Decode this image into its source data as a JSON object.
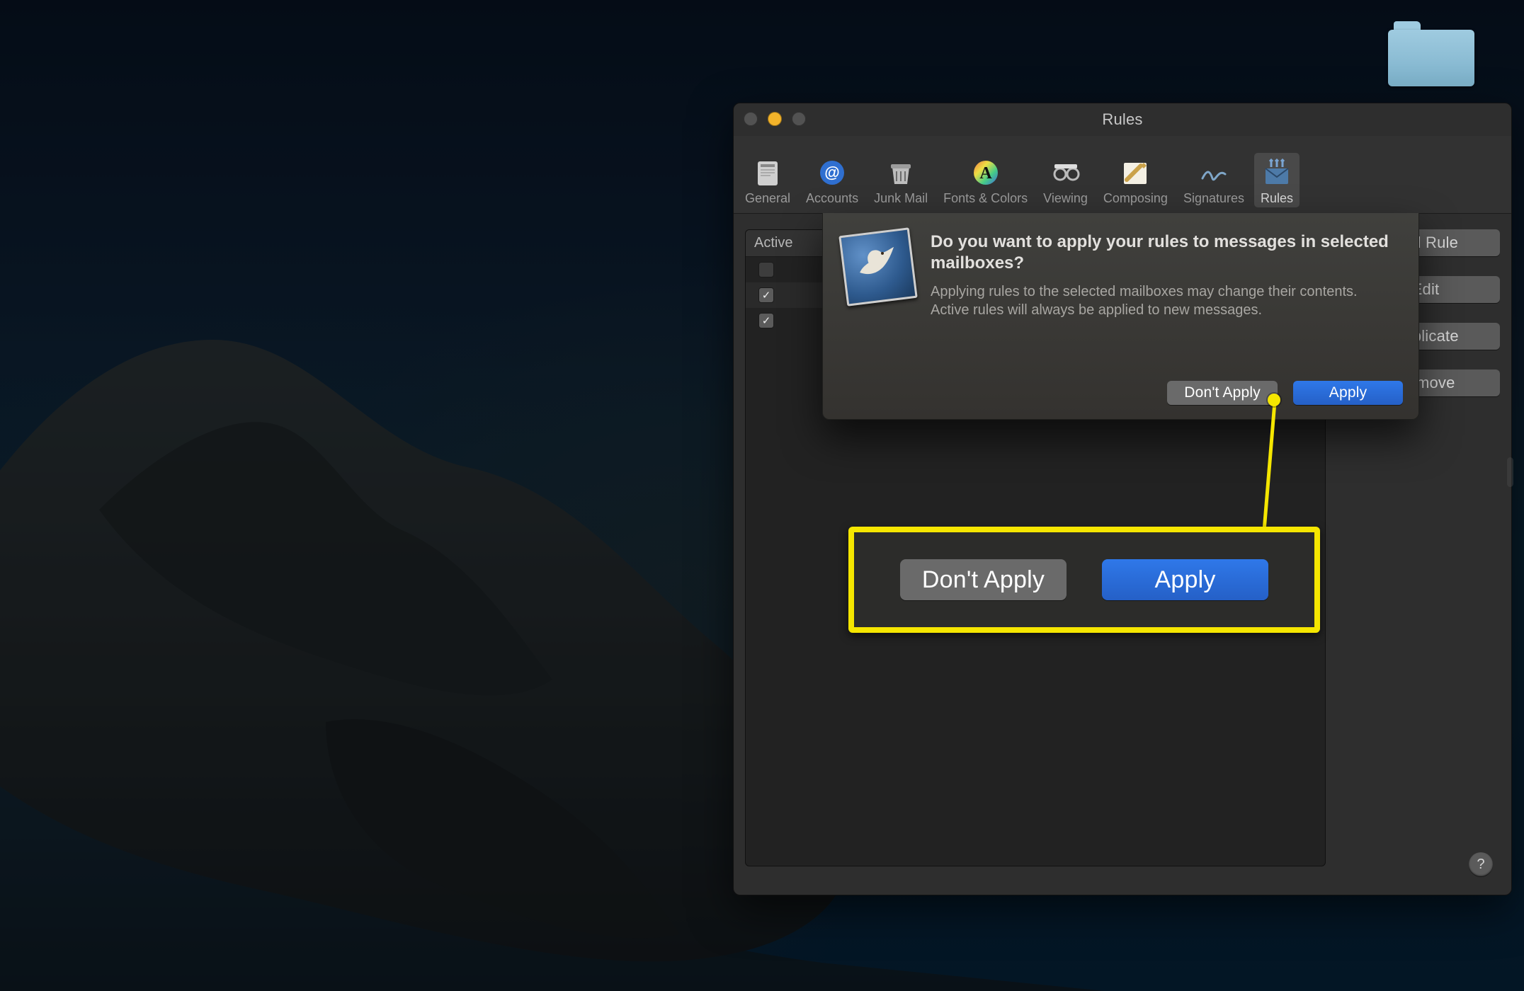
{
  "colors": {
    "accent_blue": "#2b6ddc",
    "annotation_yellow": "#f5e600"
  },
  "desktop": {
    "folder_name": ""
  },
  "window": {
    "title": "Rules",
    "toolbar": [
      {
        "id": "general",
        "label": "General"
      },
      {
        "id": "accounts",
        "label": "Accounts"
      },
      {
        "id": "junk",
        "label": "Junk Mail"
      },
      {
        "id": "fonts",
        "label": "Fonts & Colors"
      },
      {
        "id": "viewing",
        "label": "Viewing"
      },
      {
        "id": "composing",
        "label": "Composing"
      },
      {
        "id": "signatures",
        "label": "Signatures"
      },
      {
        "id": "rules",
        "label": "Rules"
      }
    ],
    "selected_tab": "rules",
    "rules_table": {
      "header_active": "Active",
      "rows": [
        {
          "active": false
        },
        {
          "active": true
        },
        {
          "active": true
        }
      ]
    },
    "side_buttons": {
      "add": "Add Rule",
      "edit": "Edit",
      "duplicate": "Duplicate",
      "remove": "Remove"
    },
    "help_glyph": "?"
  },
  "sheet": {
    "title": "Do you want to apply your rules to messages in selected mailboxes?",
    "body": "Applying rules to the selected mailboxes may change their contents. Active rules will always be applied to new messages.",
    "dont_apply": "Don't Apply",
    "apply": "Apply"
  },
  "annotation": {
    "dont_apply": "Don't Apply",
    "apply": "Apply"
  }
}
